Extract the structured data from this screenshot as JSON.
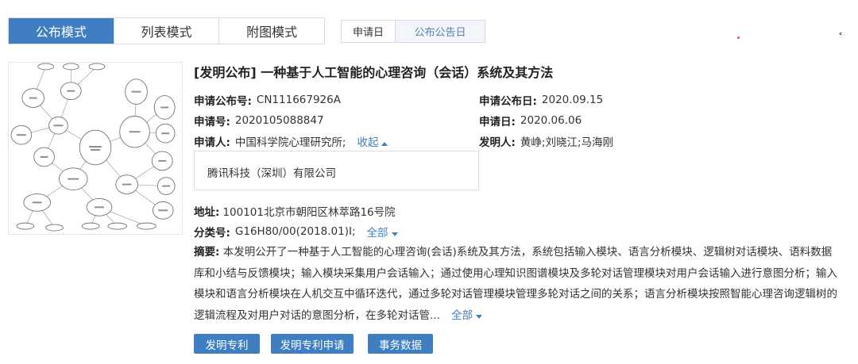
{
  "mode_tabs": [
    "公布模式",
    "列表模式",
    "附图模式"
  ],
  "date_tabs": [
    "申请日",
    "公布公告日"
  ],
  "patent": {
    "title": "[发明公布] 一种基于人工智能的心理咨询（会话）系统及其方法",
    "pub_no_label": "申请公布号:",
    "pub_no": "CN111667926A",
    "pub_date_label": "申请公布日:",
    "pub_date": "2020.09.15",
    "app_no_label": "申请号:",
    "app_no": "2020105088847",
    "app_date_label": "申请日:",
    "app_date": "2020.06.06",
    "applicant_label": "申请人:",
    "applicant": "中国科学院心理研究所;",
    "collapse_label": "收起",
    "inventor_label": "发明人:",
    "inventors": "黄峥;刘晓江;马海刚",
    "co_applicant": "腾讯科技（深圳）有限公司",
    "address_label": "地址:",
    "address": "100101北京市朝阳区林萃路16号院",
    "class_label": "分类号:",
    "class_no": "G16H80/00(2018.01)I;",
    "class_all_label": "全部",
    "abstract_label": "摘要:",
    "abstract": "本发明公开了一种基于人工智能的心理咨询(会话)系统及其方法，系统包括输入模块、语言分析模块、逻辑树对话模块、语料数据库和小结与反馈模块；输入模块采集用户会话输入；通过使用心理知识图谱模块及多轮对话管理模块对用户会话输入进行意图分析；输入模块和语言分析模块在人机交互中循环迭代，通过多轮对话管理模块管理多轮对话之间的关系；语言分析模块按照智能心理咨询逻辑树的逻辑流程及对用户对话的意图分析，在多轮对话管...",
    "abstract_all_label": "全部"
  },
  "buttons": [
    "发明专利",
    "发明专利申请",
    "事务数据"
  ],
  "colors": {
    "accent": "#3f7fc1",
    "tab_active_text": "#ffffff"
  }
}
